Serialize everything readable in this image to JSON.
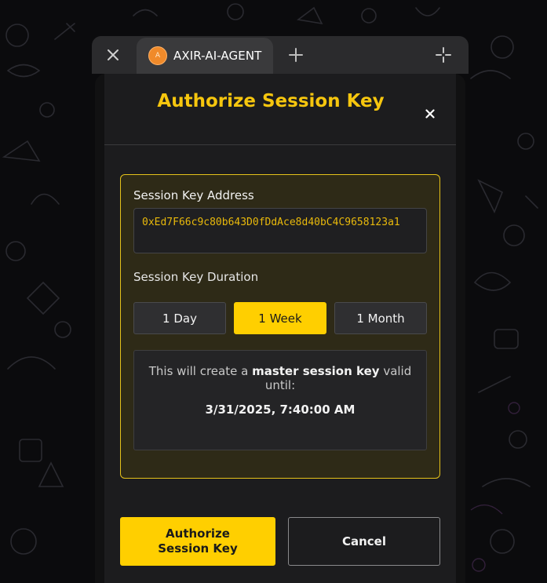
{
  "browser": {
    "tab_title": "AXIR-AI-AGENT",
    "favicon_letter": "A",
    "icons": {
      "close_tab": "close-icon",
      "new_tab": "plus-icon",
      "expand": "expand-icon"
    }
  },
  "modal": {
    "title": "Authorize Session Key",
    "close_icon": "close-icon",
    "address_label": "Session Key Address",
    "address_value": "0xEd7F66c9c80b643D0fDdAce8d40bC4C9658123a1",
    "duration_label": "Session Key Duration",
    "durations": [
      {
        "label": "1 Day",
        "selected": false
      },
      {
        "label": "1 Week",
        "selected": true
      },
      {
        "label": "1 Month",
        "selected": false
      }
    ],
    "info": {
      "prefix": "This will create a ",
      "emphasis": "master session key",
      "suffix": " valid until:",
      "date": "3/31/2025, 7:40:00 AM"
    },
    "authorize_label": "Authorize Session Key",
    "cancel_label": "Cancel"
  },
  "colors": {
    "accent": "#ffcf00",
    "title": "#f6c60e",
    "card_border": "#e5c21a",
    "address_text": "#e9b90b"
  }
}
